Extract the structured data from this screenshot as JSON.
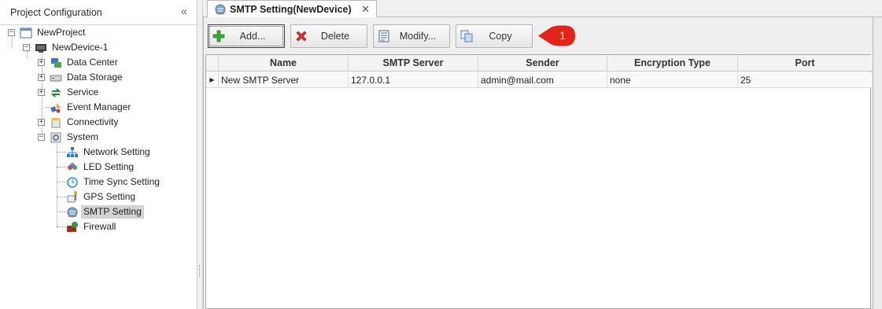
{
  "left_panel": {
    "title": "Project Configuration",
    "collapse_glyph": "«",
    "tree": {
      "project": "NewProject",
      "device": "NewDevice-1",
      "items": [
        {
          "label": "Data Center",
          "icon": "data-center-icon"
        },
        {
          "label": "Data Storage",
          "icon": "data-storage-icon"
        },
        {
          "label": "Service",
          "icon": "service-icon"
        },
        {
          "label": "Event Manager",
          "icon": "event-manager-icon"
        },
        {
          "label": "Connectivity",
          "icon": "connectivity-icon"
        },
        {
          "label": "System",
          "icon": "system-icon"
        }
      ],
      "system_children": [
        {
          "label": "Network Setting",
          "icon": "network-icon"
        },
        {
          "label": "LED Setting",
          "icon": "led-icon"
        },
        {
          "label": "Time Sync Setting",
          "icon": "clock-icon"
        },
        {
          "label": "GPS Setting",
          "icon": "gps-icon"
        },
        {
          "label": "SMTP Setting",
          "icon": "smtp-icon",
          "selected": true
        },
        {
          "label": "Firewall",
          "icon": "firewall-icon"
        }
      ]
    }
  },
  "tab": {
    "title": "SMTP Setting(NewDevice)",
    "close_glyph": "✕"
  },
  "toolbar": {
    "add_label": "Add...",
    "delete_label": "Delete",
    "modify_label": "Modify...",
    "copy_label": "Copy"
  },
  "callout": {
    "number": "1",
    "color": "#e2231a"
  },
  "grid": {
    "columns": [
      "Name",
      "SMTP Server",
      "Sender",
      "Encryption Type",
      "Port"
    ],
    "rows": [
      {
        "name": "New SMTP Server",
        "smtp_server": "127.0.0.1",
        "sender": "admin@mail.com",
        "encryption_type": "none",
        "port": "25",
        "current_row_indicator": "▶"
      }
    ]
  },
  "colors": {
    "add_green": "#3aa83a",
    "delete_red": "#d9322c",
    "callout_red": "#e2231a"
  }
}
